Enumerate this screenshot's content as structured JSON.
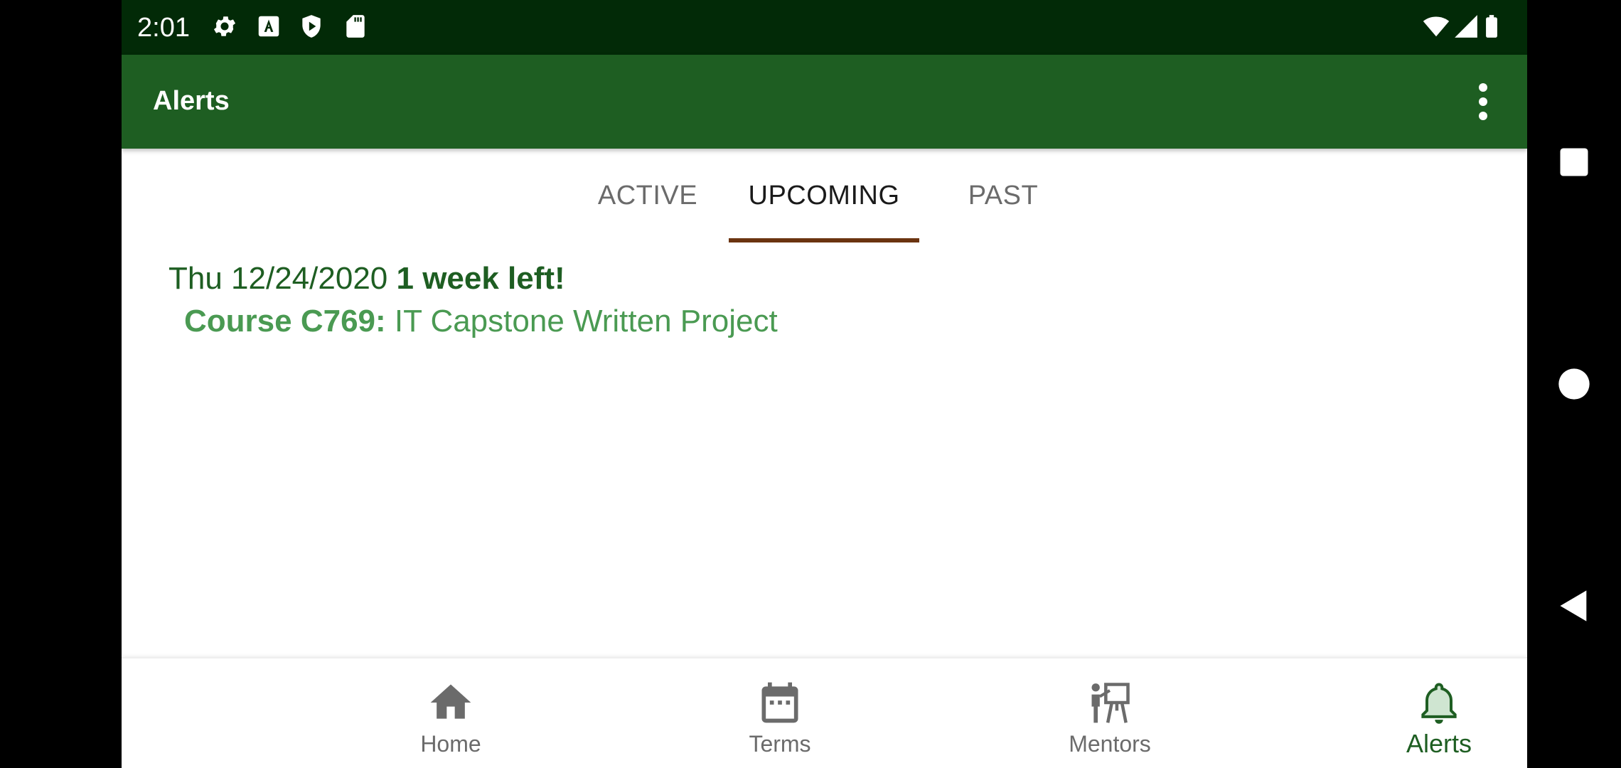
{
  "status_bar": {
    "time": "2:01",
    "left_icons": [
      "gear-icon",
      "font-a-icon",
      "shield-play-icon",
      "sd-card-icon"
    ],
    "right_icons": [
      "wifi-icon",
      "cell-signal-icon",
      "battery-icon"
    ]
  },
  "app_bar": {
    "title": "Alerts",
    "menu_icon": "more-vert-icon"
  },
  "tabs": [
    {
      "label": "ACTIVE",
      "selected": false
    },
    {
      "label": "UPCOMING",
      "selected": true
    },
    {
      "label": "PAST",
      "selected": false
    }
  ],
  "alerts": [
    {
      "date": "Thu 12/24/2020",
      "time_left": "1 week left!",
      "course_code": "Course C769:",
      "course_name": "IT Capstone Written Project"
    }
  ],
  "bottom_nav": [
    {
      "label": "Home",
      "icon": "home-icon",
      "selected": false
    },
    {
      "label": "Terms",
      "icon": "calendar-icon",
      "selected": false
    },
    {
      "label": "Mentors",
      "icon": "teacher-board-icon",
      "selected": false
    },
    {
      "label": "Alerts",
      "icon": "bell-icon",
      "selected": true
    }
  ],
  "system_nav": [
    "recents-button",
    "home-button",
    "back-button"
  ],
  "colors": {
    "status_bar": "#022A07",
    "app_bar": "#1E5E22",
    "tab_indicator": "#6B3410",
    "alert_primary": "#1E5E22",
    "alert_secondary": "#4A9A52",
    "nav_inactive": "#6B6B6B"
  }
}
